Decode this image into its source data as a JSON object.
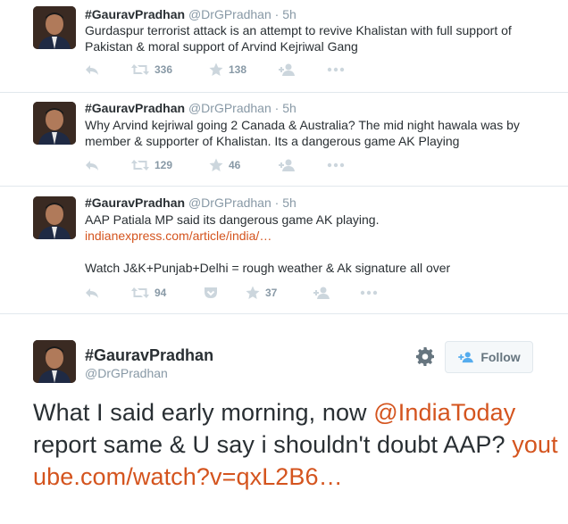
{
  "tweets": [
    {
      "name": "#GauravPradhan",
      "handle": "@DrGPradhan",
      "time": "5h",
      "text": "Gurdaspur terrorist attack is an attempt to revive Khalistan with full support of Pakistan & moral support of Arvind Kejriwal Gang",
      "retweets": "336",
      "favorites": "138"
    },
    {
      "name": "#GauravPradhan",
      "handle": "@DrGPradhan",
      "time": "5h",
      "text": "Why Arvind kejriwal going 2 Canada & Australia? The mid night hawala was by member & supporter of Khalistan. Its a dangerous game AK Playing",
      "retweets": "129",
      "favorites": "46"
    },
    {
      "name": "#GauravPradhan",
      "handle": "@DrGPradhan",
      "time": "5h",
      "text_line1": "AAP Patiala MP said its dangerous game AK playing.",
      "link": "indianexpress.com/article/india/…",
      "text_line3": "Watch J&K+Punjab+Delhi = rough weather & Ak signature all over",
      "retweets": "94",
      "favorites": "37"
    }
  ],
  "expanded": {
    "name": "#GauravPradhan",
    "handle": "@DrGPradhan",
    "follow_label": "Follow",
    "text_part1": "What I said early morning, now ",
    "mention": "@IndiaToday",
    "text_part2": " report same & U say i shouldn't doubt AAP? ",
    "link": "youtube.com/watch?v=qxL2B6…"
  },
  "colors": {
    "link": "#d4541e",
    "muted": "#8899a6",
    "text": "#292f33",
    "border": "#e1e8ed"
  },
  "icons": [
    "reply-icon",
    "retweet-icon",
    "favorite-icon",
    "follow-user-icon",
    "more-icon",
    "pocket-icon",
    "gear-icon"
  ]
}
